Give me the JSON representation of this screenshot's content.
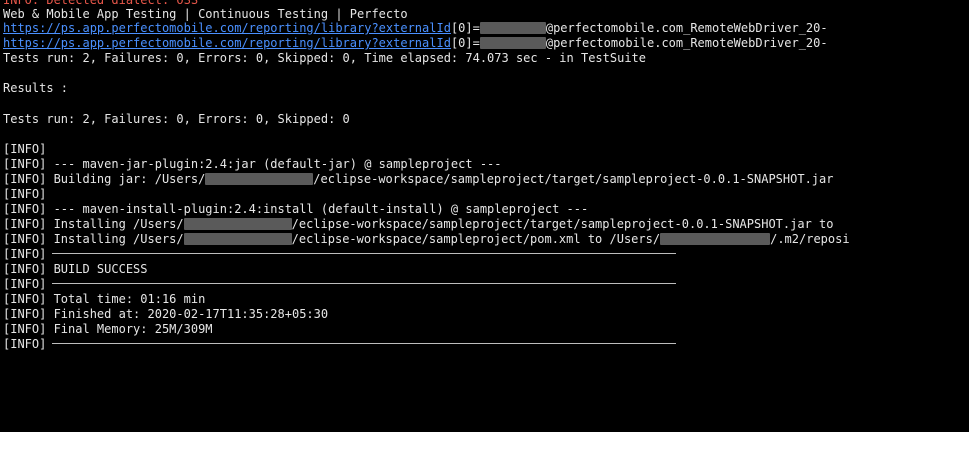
{
  "terminal": {
    "line0": "INFO: Detected dialect: OSS",
    "line1": "Web & Mobile App Testing | Continuous Testing | Perfecto",
    "link": "https://ps.app.perfectomobile.com/reporting/library?externalId",
    "link_suffix_a": "[0]=",
    "link_suffix_b": "@perfectomobile.com_RemoteWebDriver_20-",
    "tests_run_suite": "Tests run: 2, Failures: 0, Errors: 0, Skipped: 0, Time elapsed: 74.073 sec - in TestSuite",
    "results": "Results :",
    "tests_run": "Tests run: 2, Failures: 0, Errors: 0, Skipped: 0",
    "info": "[INFO]",
    "jar_plugin": "[INFO] --- maven-jar-plugin:2.4:jar (default-jar) @ sampleproject ---",
    "building_a": "[INFO] Building jar: /Users/",
    "building_b": "/eclipse-workspace/sampleproject/target/sampleproject-0.0.1-SNAPSHOT.jar",
    "install_plugin": "[INFO] --- maven-install-plugin:2.4:install (default-install) @ sampleproject ---",
    "installing_a": "[INFO] Installing /Users/",
    "installing_jar_b": "/eclipse-workspace/sampleproject/target/sampleproject-0.0.1-SNAPSHOT.jar to",
    "installing_pom_b": "/eclipse-workspace/sampleproject/pom.xml to /Users/",
    "installing_pom_c": "/.m2/reposi",
    "build_success": "[INFO] BUILD SUCCESS",
    "total_time": "[INFO] Total time: 01:16 min",
    "finished_at": "[INFO] Finished at: 2020-02-17T11:35:28+05:30",
    "final_memory": "[INFO] Final Memory: 25M/309M"
  },
  "colors": {
    "background": "#000000",
    "text": "#e6e6e6",
    "warning": "#e45649",
    "link": "#4a90ff",
    "redaction": "#5a5a5a"
  }
}
